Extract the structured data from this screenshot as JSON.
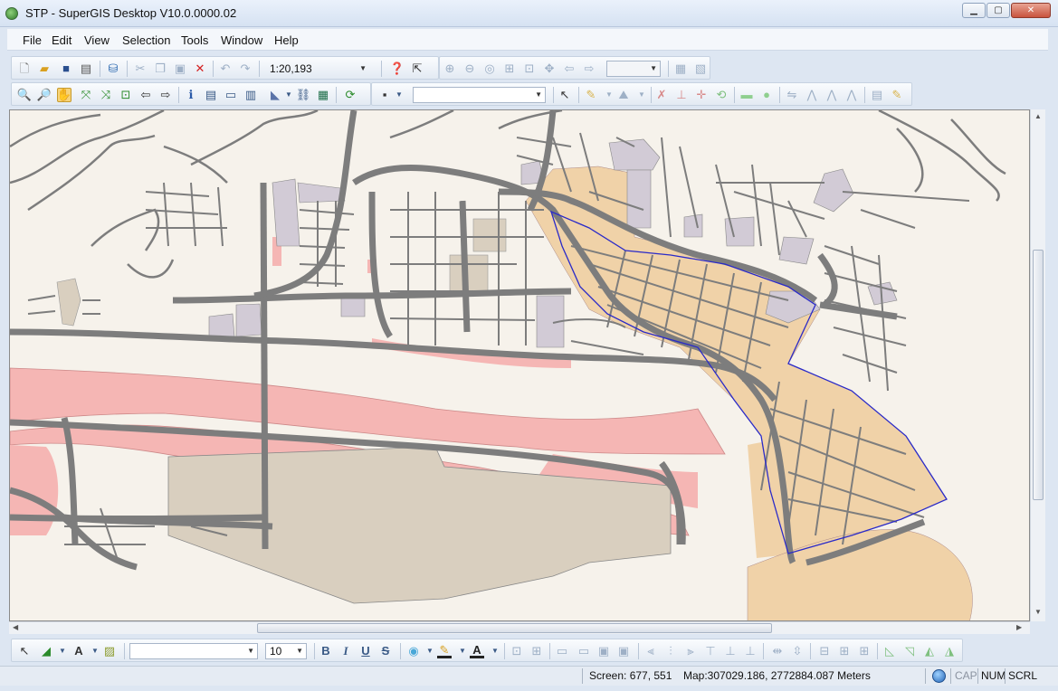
{
  "window": {
    "title": "STP - SuperGIS Desktop V10.0.0000.02",
    "minimize": "▁",
    "maximize": "▢",
    "close": "✕"
  },
  "menu": [
    "File",
    "Edit",
    "View",
    "Selection",
    "Tools",
    "Window",
    "Help"
  ],
  "standard_toolbar": {
    "scale_value": "1:20,193"
  },
  "text_toolbar": {
    "font_size": "10",
    "bold_label": "B",
    "italic_label": "I",
    "underline_label": "U",
    "strike_label": "S"
  },
  "status": {
    "screen": "Screen: 677, 551",
    "map": "Map:307029.186, 2772884.087 Meters",
    "cap": "CAP",
    "num": "NUM",
    "scrl": "SCRL"
  },
  "map_colors": {
    "background": "#f6f2eb",
    "road": "#7d7d7d",
    "urban": "#f0d2a8",
    "river_flood": "#f5b6b4",
    "industrial": "#d9cfbf",
    "public": "#d2cbd6",
    "selection_outline": "#2a2ac8"
  }
}
